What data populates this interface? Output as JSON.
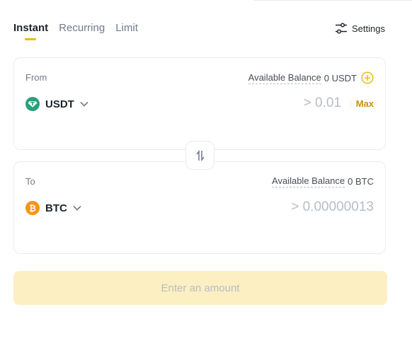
{
  "tabs": [
    {
      "label": "Instant",
      "active": true
    },
    {
      "label": "Recurring",
      "active": false
    },
    {
      "label": "Limit",
      "active": false
    }
  ],
  "settings": {
    "label": "Settings",
    "icon": "sliders-icon"
  },
  "from": {
    "label": "From",
    "balance_label": "Available Balance",
    "balance_value": "0 USDT",
    "coin": "USDT",
    "coin_icon": "usdt-icon",
    "amount_placeholder": "> 0.01",
    "max_label": "Max"
  },
  "to": {
    "label": "To",
    "balance_label": "Available Balance",
    "balance_value": "0 BTC",
    "coin": "BTC",
    "coin_icon": "btc-icon",
    "amount_placeholder": "> 0.00000013"
  },
  "cta": {
    "label": "Enter an amount"
  },
  "colors": {
    "accent": "#f0b90b",
    "max": "#c99400",
    "usdt": "#26a17b",
    "btc": "#f7931a",
    "cta_bg": "#fcefc2"
  }
}
